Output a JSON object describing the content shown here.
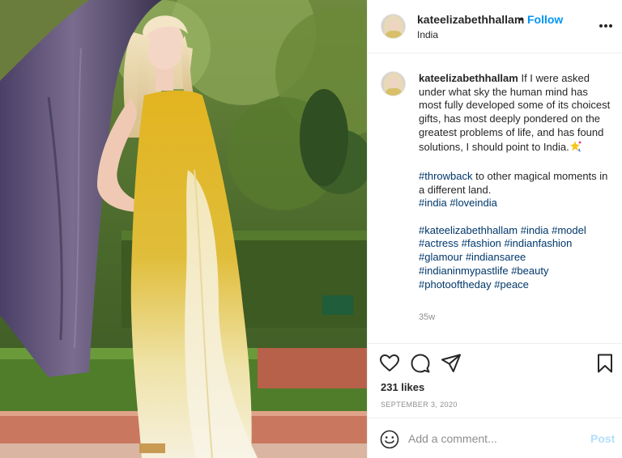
{
  "post": {
    "image_alt": "Woman in a yellow and white ombre saree standing in a garden beside a large tree",
    "header": {
      "username": "kateelizabethhallam",
      "separator": "•",
      "follow_label": "Follow",
      "location": "India"
    },
    "caption": {
      "username": "kateelizabethhallam",
      "text": "If I were asked under what sky the human mind has most fully developed some of its choicest gifts, has most deeply pondered on the greatest problems of life, and has found solutions, I should point to India.",
      "emoji": "sparkle-star-emoji",
      "line2_tag": "#throwback",
      "line2_text": " to other magical moments in a different land.",
      "line2_hashtags": [
        "#india",
        "#loveindia"
      ],
      "hashtags": [
        "#kateelizabethhallam",
        "#india",
        "#model",
        "#actress",
        "#fashion",
        "#indianfashion",
        "#glamour",
        "#indiansaree",
        "#indianinmypastlife",
        "#beauty",
        "#photooftheday",
        "#peace"
      ],
      "time_ago": "35w"
    },
    "actions": {
      "icons": [
        "heart-icon",
        "comment-icon",
        "share-icon",
        "bookmark-icon"
      ],
      "likes": "231 likes",
      "date": "SEPTEMBER 3, 2020"
    },
    "comment": {
      "placeholder": "Add a comment...",
      "post_label": "Post",
      "icon": "smiley-icon"
    },
    "colors": {
      "link_blue": "#0095f6",
      "hashtag_blue": "#00376b",
      "muted": "#8e8e8e",
      "post_disabled": "#b2dffc"
    }
  }
}
